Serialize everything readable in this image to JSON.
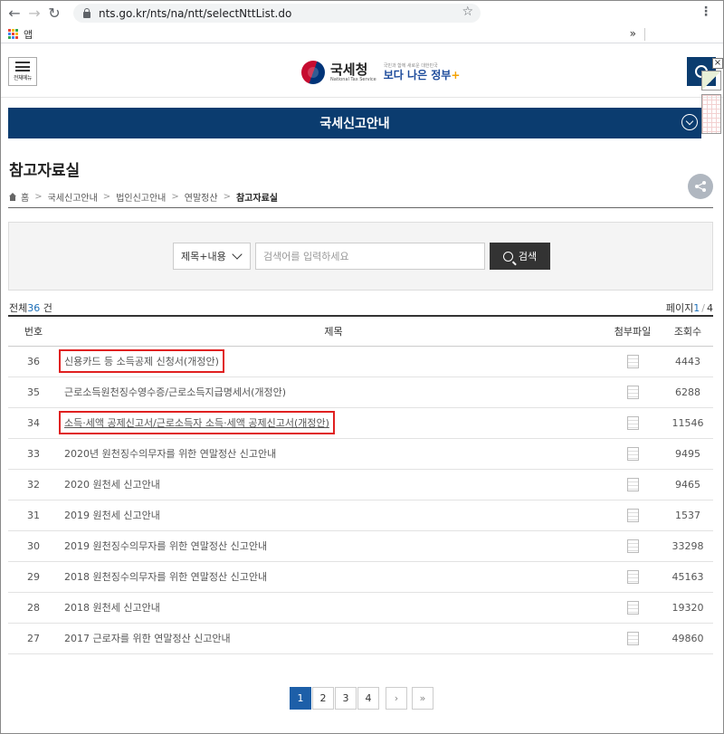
{
  "browser": {
    "url": "nts.go.kr/nts/na/ntt/selectNttList.do",
    "bookmark_apps_label": "앱",
    "bookmark_more": "»"
  },
  "header": {
    "menu_label": "전체메뉴",
    "logo_ko": "국세청",
    "logo_en": "National Tax Service",
    "slogan_small": "국민과 함께 새로운 대한민국",
    "slogan_main": "보다 나은 정부",
    "brand_color": "#0b3c6f"
  },
  "section": {
    "title": "국세신고안내"
  },
  "page": {
    "title": "참고자료실"
  },
  "breadcrumb": {
    "home": "홈",
    "items": [
      "국세신고안내",
      "법인신고안내",
      "연말정산"
    ],
    "current": "참고자료실"
  },
  "search": {
    "select_value": "제목+내용",
    "placeholder": "검색어를 입력하세요",
    "button": "검색"
  },
  "list_info": {
    "total_prefix": "전체",
    "total_count": "36",
    "total_suffix": "건",
    "page_label": "페이지",
    "page_current": "1",
    "page_total": "4"
  },
  "table": {
    "headers": [
      "번호",
      "제목",
      "첨부파일",
      "조회수"
    ],
    "rows": [
      {
        "num": "36",
        "title": "신용카드 등 소득공제 신청서(개정안)",
        "views": "4443"
      },
      {
        "num": "35",
        "title": "근로소득원천징수영수증/근로소득지급명세서(개정안)",
        "views": "6288"
      },
      {
        "num": "34",
        "title": "소득·세액 공제신고서/근로소득자 소득·세액 공제신고서(개정안)",
        "views": "11546"
      },
      {
        "num": "33",
        "title": "2020년 원천징수의무자를 위한 연말정산 신고안내",
        "views": "9495"
      },
      {
        "num": "32",
        "title": "2020 원천세 신고안내",
        "views": "9465"
      },
      {
        "num": "31",
        "title": "2019 원천세 신고안내",
        "views": "1537"
      },
      {
        "num": "30",
        "title": "2019 원천징수의무자를 위한 연말정산 신고안내",
        "views": "33298"
      },
      {
        "num": "29",
        "title": "2018 원천징수의무자를 위한 연말정산 신고안내",
        "views": "45163"
      },
      {
        "num": "28",
        "title": "2018 원천세 신고안내",
        "views": "19320"
      },
      {
        "num": "27",
        "title": "2017 근로자를 위한 연말정산 신고안내",
        "views": "49860"
      }
    ]
  },
  "pagination": {
    "pages": [
      "1",
      "2",
      "3",
      "4"
    ],
    "current": "1",
    "next": "›",
    "last": "»"
  }
}
